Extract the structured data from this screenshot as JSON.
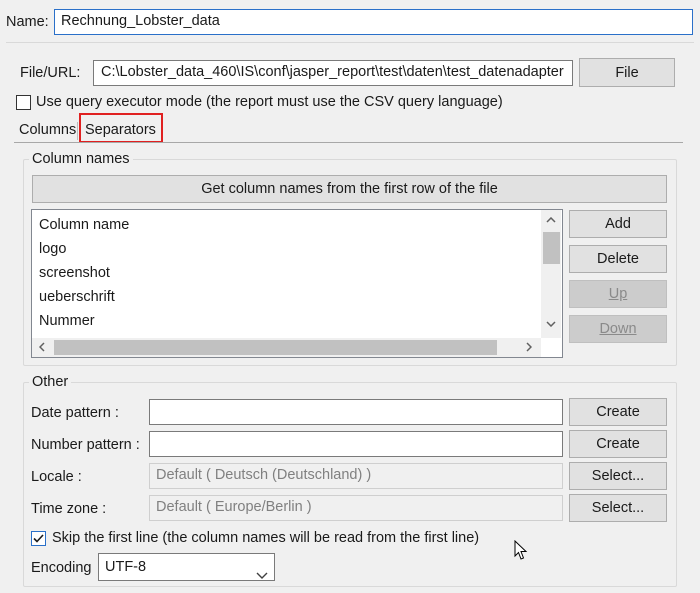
{
  "name": {
    "label": "Name:",
    "value": "Rechnung_Lobster_data"
  },
  "file": {
    "label": "File/URL:",
    "value": "C:\\Lobster_data_460\\IS\\conf\\jasper_report\\test\\daten\\test_datenadapter",
    "button": "File"
  },
  "query_mode": {
    "label": "Use query executor mode (the report must use the CSV query language)",
    "checked": false
  },
  "tabs": [
    {
      "label": "Columns"
    },
    {
      "label": "Separators",
      "highlight_color": "#e02020"
    }
  ],
  "column_names": {
    "legend": "Column names",
    "get_button": "Get column names from the first row of the file",
    "header": "Column name",
    "rows": [
      "logo",
      "screenshot",
      "ueberschrift",
      "Nummer"
    ],
    "buttons": {
      "add": "Add",
      "delete": "Delete",
      "up": "Up",
      "down": "Down"
    }
  },
  "other": {
    "legend": "Other",
    "date_pattern": {
      "label": "Date pattern :",
      "value": "",
      "button": "Create"
    },
    "number_pattern": {
      "label": "Number pattern :",
      "value": "",
      "button": "Create"
    },
    "locale": {
      "label": "Locale :",
      "value": "Default ( Deutsch (Deutschland) )",
      "button": "Select..."
    },
    "time_zone": {
      "label": "Time zone :",
      "value": "Default ( Europe/Berlin )",
      "button": "Select..."
    },
    "skip_first_line": {
      "label": "Skip the first line (the column names will be read from the first line)",
      "checked": true
    },
    "encoding": {
      "label": "Encoding",
      "value": "UTF-8"
    }
  }
}
